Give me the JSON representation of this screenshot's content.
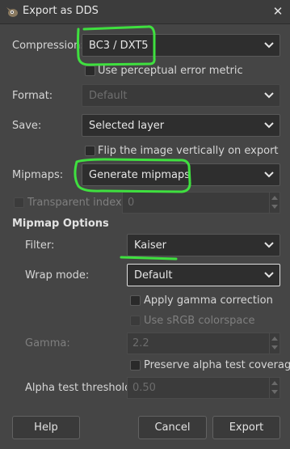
{
  "window": {
    "title": "Export as DDS"
  },
  "labels": {
    "compression": "Compression:",
    "perceptual": "Use perceptual error metric",
    "format": "Format:",
    "save": "Save:",
    "flip": "Flip the image vertically on export",
    "mipmaps": "Mipmaps:",
    "transparent_index": "Transparent index:",
    "mipmap_options": "Mipmap Options",
    "filter": "Filter:",
    "wrap_mode": "Wrap mode:",
    "gamma_correction": "Apply gamma correction",
    "srgb": "Use sRGB colorspace",
    "gamma": "Gamma:",
    "preserve_alpha": "Preserve alpha test coverage",
    "alpha_threshold": "Alpha test threshold:"
  },
  "values": {
    "compression": "BC3 / DXT5",
    "format": "Default",
    "save": "Selected layer",
    "mipmaps": "Generate mipmaps",
    "transparent_index": "0",
    "filter": "Kaiser",
    "wrap_mode": "Default",
    "gamma": "2.2",
    "alpha_threshold": "0.50"
  },
  "buttons": {
    "help": "Help",
    "cancel": "Cancel",
    "export": "Export"
  },
  "colors": {
    "annotation": "#3fe03f"
  }
}
